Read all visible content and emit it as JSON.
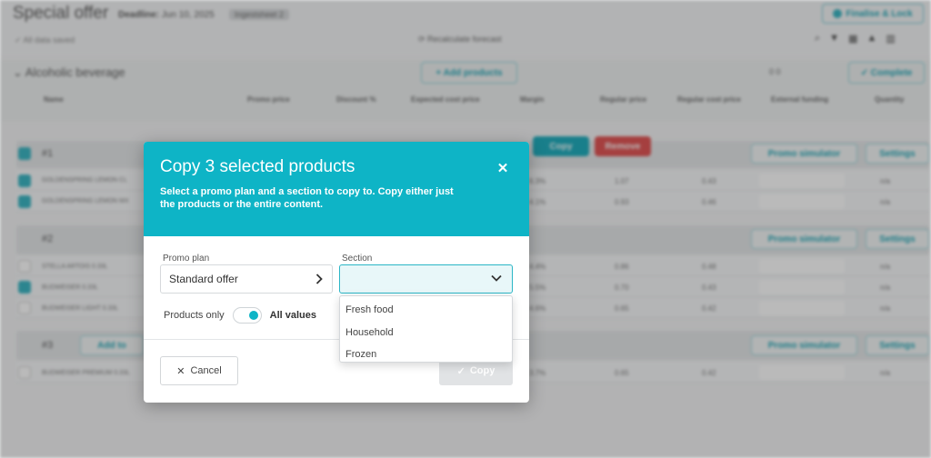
{
  "background": {
    "title": "Special offer",
    "deadline_label": "Deadline:",
    "deadline_value": "Jun 10, 2025",
    "badge": "Ingestsheet 2",
    "finalise_label": "Finalise & Lock",
    "saved_status": "All data saved",
    "recalculate_label": "Recalculate forecast",
    "section_title": "Alcoholic beverage",
    "add_products_label": "+ Add products",
    "complete_label": "✓ Complete",
    "counts": "0   0",
    "columns": [
      "Name",
      "Promo price",
      "Discount %",
      "Expected cost price",
      "Margin",
      "Regular price",
      "Regular cost price",
      "External funding",
      "Quantity"
    ],
    "toolbar": {
      "copy_label": "Copy",
      "remove_label": "Remove"
    },
    "promo_simulator_label": "Promo simulator",
    "settings_label": "Settings",
    "add_to_label": "Add to",
    "groups": [
      {
        "label": "#1",
        "rows": [
          {
            "name": "GOLDENSPRING LEMON CL",
            "margin": "6.3%",
            "regular_price": "1.07",
            "regular_cost": "0.43",
            "qty": "n/a"
          },
          {
            "name": "GOLDENSPRING LEMON MX",
            "margin": "4.1%",
            "regular_price": "0.93",
            "regular_cost": "0.46",
            "qty": "n/a"
          }
        ]
      },
      {
        "label": "#2",
        "rows": [
          {
            "name": "STELLA ARTOIS 0.33L",
            "margin": "4.4%",
            "regular_price": "0.86",
            "regular_cost": "0.48",
            "qty": "n/a"
          },
          {
            "name": "BUDWEISER 0.33L",
            "margin": "5.5%",
            "regular_price": "0.70",
            "regular_cost": "0.43",
            "qty": "n/a"
          },
          {
            "name": "BUDWEISER LIGHT 0.33L",
            "margin": "4.6%",
            "regular_price": "0.65",
            "regular_cost": "0.42",
            "qty": "n/a"
          }
        ]
      },
      {
        "label": "#3",
        "rows": [
          {
            "name": "BUDWEISER PREMIUM 0.33L",
            "margin": "3.7%",
            "regular_price": "0.65",
            "regular_cost": "0.42",
            "qty": "n/a"
          }
        ]
      }
    ]
  },
  "modal": {
    "title": "Copy 3 selected products",
    "description": "Select a promo plan and a section to copy to. Copy either just the products or the entire content.",
    "promo_plan_label": "Promo plan",
    "promo_plan_value": "Standard offer",
    "section_label": "Section",
    "section_value": "",
    "section_options": [
      "Fresh food",
      "Household",
      "Frozen"
    ],
    "toggle_left_label": "Products only",
    "toggle_right_label": "All values",
    "toggle_state": "All values",
    "cancel_label": "Cancel",
    "copy_label": "Copy"
  },
  "colors": {
    "accent": "#0eb4c6",
    "danger": "#e04a4a"
  }
}
